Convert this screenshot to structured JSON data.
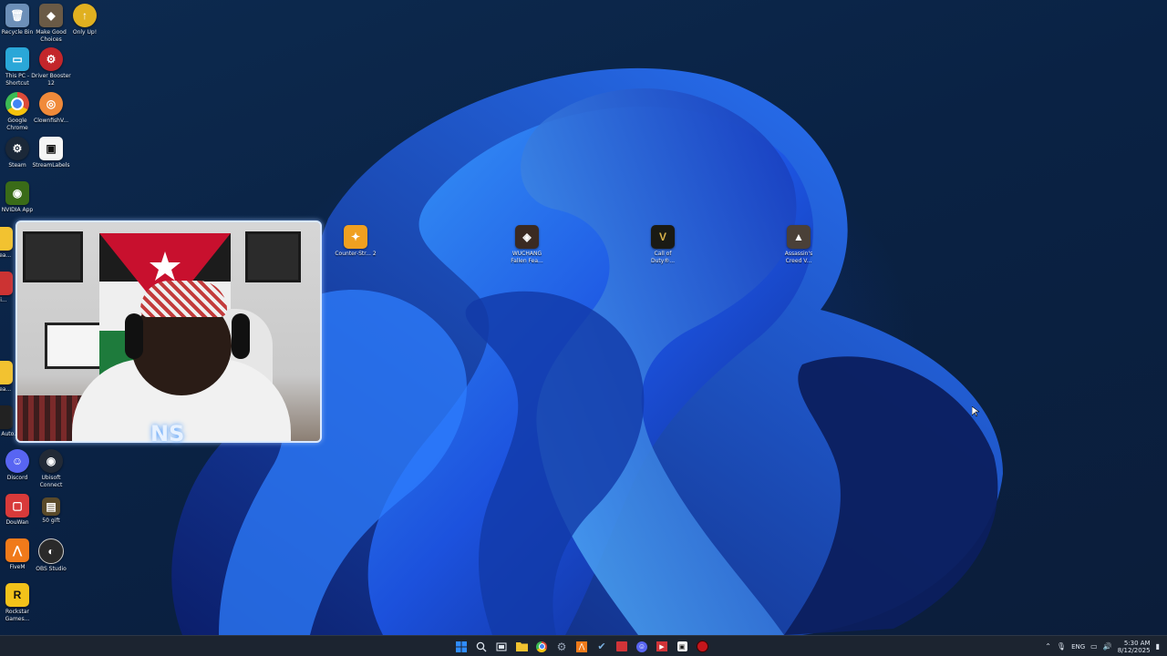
{
  "desktop": {
    "left_icons": [
      {
        "label": "Recycle Bin",
        "icon": "recycle-bin-icon",
        "color": "#6c8fb8"
      },
      {
        "label": "Make Good Choices",
        "icon": "game-icon",
        "color": "#6a5a46"
      },
      {
        "label": "Only Up!",
        "icon": "only-up-icon",
        "color": "#e0b020"
      },
      {
        "label": "This PC - Shortcut",
        "icon": "pc-icon",
        "color": "#2aa7d8"
      },
      {
        "label": "Driver Booster 12",
        "icon": "driver-booster-icon",
        "color": "#c3262b"
      },
      {
        "label": "Google Chrome",
        "icon": "chrome-icon",
        "color": "#dd4b39"
      },
      {
        "label": "ClownfishV...",
        "icon": "clownfish-icon",
        "color": "#f08a3a"
      },
      {
        "label": "Steam",
        "icon": "steam-icon",
        "color": "#1b2838"
      },
      {
        "label": "StreamLabels",
        "icon": "streamlabels-icon",
        "color": "#f5f5f5"
      },
      {
        "label": "NVIDIA App",
        "icon": "nvidia-icon",
        "color": "#3a6b18"
      },
      {
        "label": "Discord",
        "icon": "discord-icon",
        "color": "#5865f2"
      },
      {
        "label": "Ubisoft Connect",
        "icon": "ubisoft-icon",
        "color": "#222a36"
      },
      {
        "label": "DouWan",
        "icon": "douwan-icon",
        "color": "#d83a3a"
      },
      {
        "label": "50 gift",
        "icon": "gift-icon",
        "color": "#5a4a2a"
      },
      {
        "label": "FiveM",
        "icon": "fivem-icon",
        "color": "#f07a1a"
      },
      {
        "label": "OBS Studio",
        "icon": "obs-icon",
        "color": "#2a2a2a"
      },
      {
        "label": "Rockstar Games...",
        "icon": "rockstar-icon",
        "color": "#f2c21a"
      }
    ],
    "center_icons": [
      {
        "label": "Counter-Str... 2",
        "icon": "counter-strike-icon",
        "color": "#f0a020"
      },
      {
        "label": "WUCHANG Fallen Fea...",
        "icon": "wuchang-icon",
        "color": "#3a2a22"
      },
      {
        "label": "Call of Duty®...",
        "icon": "call-of-duty-icon",
        "color": "#1a1a14"
      },
      {
        "label": "Assassin's Creed V...",
        "icon": "assassins-creed-icon",
        "color": "#4a4038"
      }
    ],
    "partial_left_labels": [
      "Relea...",
      "Wi...",
      "Relea...",
      "Grand Auto..."
    ]
  },
  "webcam": {
    "overlay_logo": "NS"
  },
  "taskbar": {
    "items": [
      {
        "icon": "windows-start-icon",
        "color": "#2f8cff"
      },
      {
        "icon": "search-icon",
        "color": "#dfe6f0"
      },
      {
        "icon": "task-view-icon",
        "color": "#dfe6f0"
      },
      {
        "icon": "file-explorer-icon",
        "color": "#f2c230"
      },
      {
        "icon": "chrome-icon",
        "color": "#dd4b39"
      },
      {
        "icon": "settings-icon",
        "color": "#9aa6b8"
      },
      {
        "icon": "fivem-icon",
        "color": "#f07a1a"
      },
      {
        "icon": "steam-icon",
        "color": "#4a7ab0"
      },
      {
        "icon": "calendar-icon",
        "color": "#d13438"
      },
      {
        "icon": "discord-icon",
        "color": "#5865f2"
      },
      {
        "icon": "media-icon",
        "color": "#d13438"
      },
      {
        "icon": "streamlabels-icon",
        "color": "#f5f5f5"
      },
      {
        "icon": "record-icon",
        "color": "#c4161c"
      }
    ],
    "tray": {
      "language": "ENG",
      "time": "5:30 AM",
      "date": "8/12/2025"
    }
  }
}
